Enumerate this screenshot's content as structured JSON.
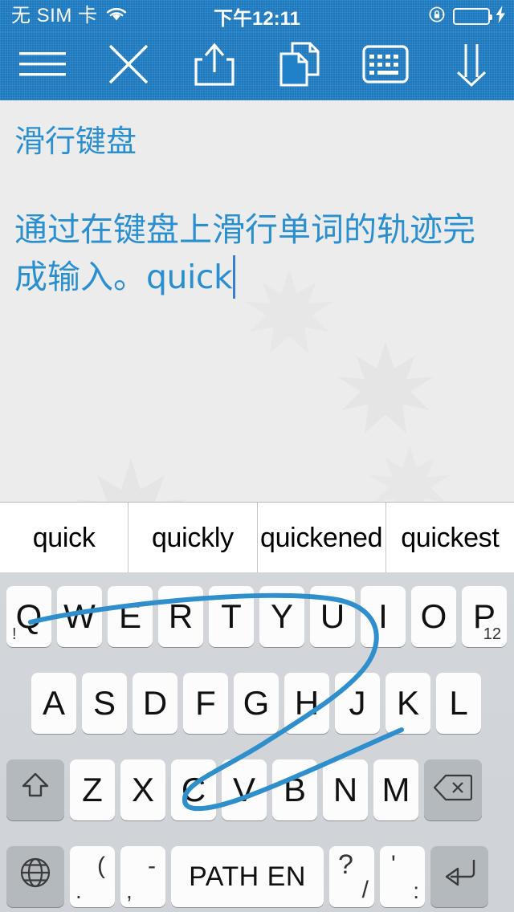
{
  "statusbar": {
    "carrier": "无 SIM 卡",
    "wifi_icon": "wifi-icon",
    "time": "下午12:11",
    "rotation_lock_icon": "rotation-lock-icon",
    "battery_icon": "battery-icon",
    "charging_icon": "charging-bolt-icon",
    "battery_color": "#4cd964",
    "bar_color": "#2080c8"
  },
  "toolbar": {
    "items": [
      {
        "name": "menu-button",
        "icon": "hamburger-menu-icon"
      },
      {
        "name": "close-button",
        "icon": "close-x-icon"
      },
      {
        "name": "share-button",
        "icon": "share-upload-icon"
      },
      {
        "name": "copy-button",
        "icon": "copy-documents-icon"
      },
      {
        "name": "keyboard-button",
        "icon": "keyboard-icon"
      },
      {
        "name": "hide-keyboard-button",
        "icon": "double-down-arrow-icon"
      }
    ]
  },
  "document": {
    "title": "滑行键盘",
    "body_cjk": "通过在键盘上滑行单词的轨迹完成输入。",
    "body_typed": "quick",
    "text_color": "#2a8fd0",
    "background_color": "#ececec",
    "caret_visible": true
  },
  "suggestions": {
    "items": [
      "quick",
      "quickly",
      "quickened",
      "quickest"
    ]
  },
  "keyboard": {
    "language_label": "PATH EN",
    "row1": [
      {
        "label": "Q",
        "sub": "!",
        "sub_pos": "bl"
      },
      {
        "label": "W"
      },
      {
        "label": "E"
      },
      {
        "label": "R"
      },
      {
        "label": "T"
      },
      {
        "label": "Y"
      },
      {
        "label": "U"
      },
      {
        "label": "I"
      },
      {
        "label": "O"
      },
      {
        "label": "P",
        "sub": "12",
        "sub_pos": "br"
      }
    ],
    "row2": [
      {
        "label": "A"
      },
      {
        "label": "S"
      },
      {
        "label": "D"
      },
      {
        "label": "F"
      },
      {
        "label": "G"
      },
      {
        "label": "H"
      },
      {
        "label": "J"
      },
      {
        "label": "K"
      },
      {
        "label": "L"
      }
    ],
    "row3": [
      {
        "label": "Z"
      },
      {
        "label": "X"
      },
      {
        "label": "C"
      },
      {
        "label": "V"
      },
      {
        "label": "B"
      },
      {
        "label": "N"
      },
      {
        "label": "M"
      }
    ],
    "shift_icon": "shift-arrow-icon",
    "backspace_icon": "backspace-delete-icon",
    "globe_icon": "globe-language-icon",
    "return_icon": "return-enter-icon",
    "punct1_top": "(",
    "punct1_bottom": ".",
    "punct2_top": "-",
    "punct2_bottom": ",",
    "punct3_top": "?",
    "punct3_bottom": "/",
    "punct4_top": "'",
    "punct4_bottom": ":",
    "swipe_trace_color": "#2f8fcc",
    "key_bg": "#fcfcfc",
    "modifier_key_bg": "#b4b9be",
    "keyboard_bg": "#d1d5d9"
  }
}
